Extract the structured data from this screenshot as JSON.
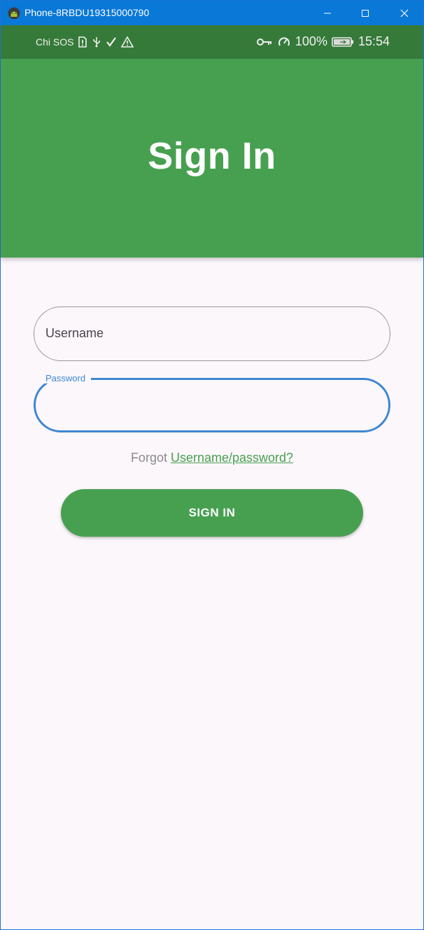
{
  "window": {
    "title": "Phone-8RBDU19315000790",
    "icon": "android-icon"
  },
  "status_bar": {
    "carrier": "Chi SOS",
    "battery": "100%",
    "time": "15:54",
    "icons": [
      "sim-alert-icon",
      "usb-icon",
      "check-icon",
      "warning-icon",
      "vpn-key-icon",
      "data-saver-icon",
      "battery-icon"
    ]
  },
  "header": {
    "title": "Sign In",
    "color": "#47a050"
  },
  "form": {
    "username": {
      "placeholder": "Username",
      "value": ""
    },
    "password": {
      "label": "Password",
      "value": ""
    },
    "forgot_prefix": "Forgot",
    "forgot_link": "Username/password?",
    "submit_label": "SIGN IN"
  },
  "colors": {
    "accent": "#47a050",
    "status_bar": "#367a3a",
    "focus": "#3d86d4",
    "background": "#fcf7fb",
    "titlebar": "#0a78d7"
  }
}
